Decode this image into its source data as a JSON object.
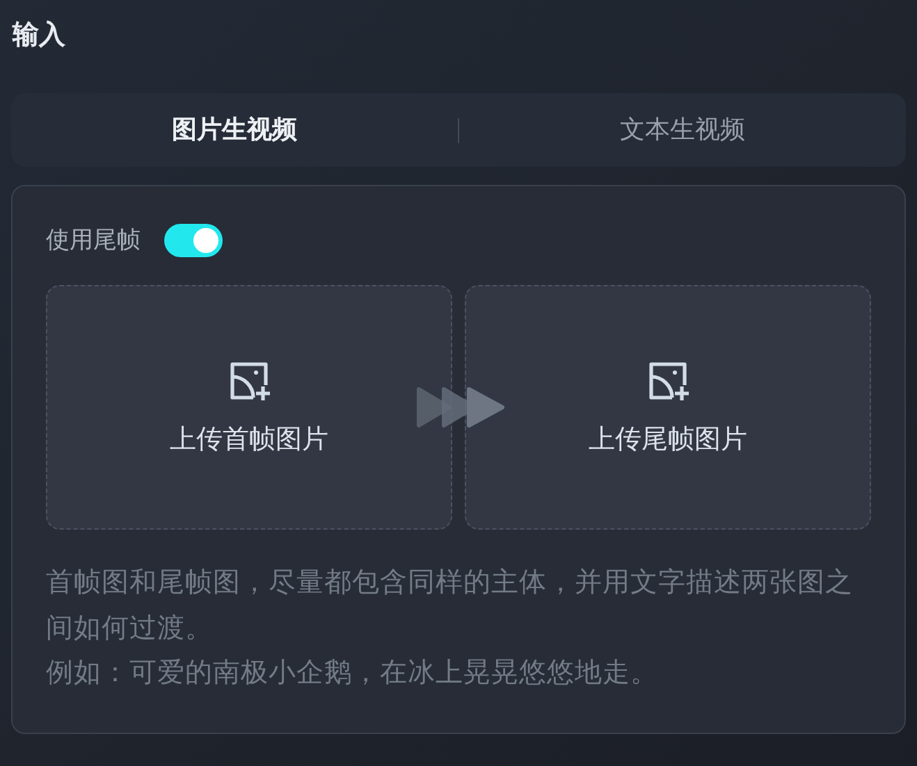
{
  "section_title": "输入",
  "tabs": [
    {
      "label": "图片生视频",
      "selected": true
    },
    {
      "label": "文本生视频",
      "selected": false
    }
  ],
  "end_frame_toggle": {
    "label": "使用尾帧",
    "on": true
  },
  "upload_slots": [
    {
      "label": "上传首帧图片"
    },
    {
      "label": "上传尾帧图片"
    }
  ],
  "hint": [
    "首帧图和尾帧图，尽量都包含同样的主体，并用文字描述两张图之间如何过渡。",
    "例如：可爱的南极小企鹅，在冰上晃晃悠悠地走。"
  ]
}
